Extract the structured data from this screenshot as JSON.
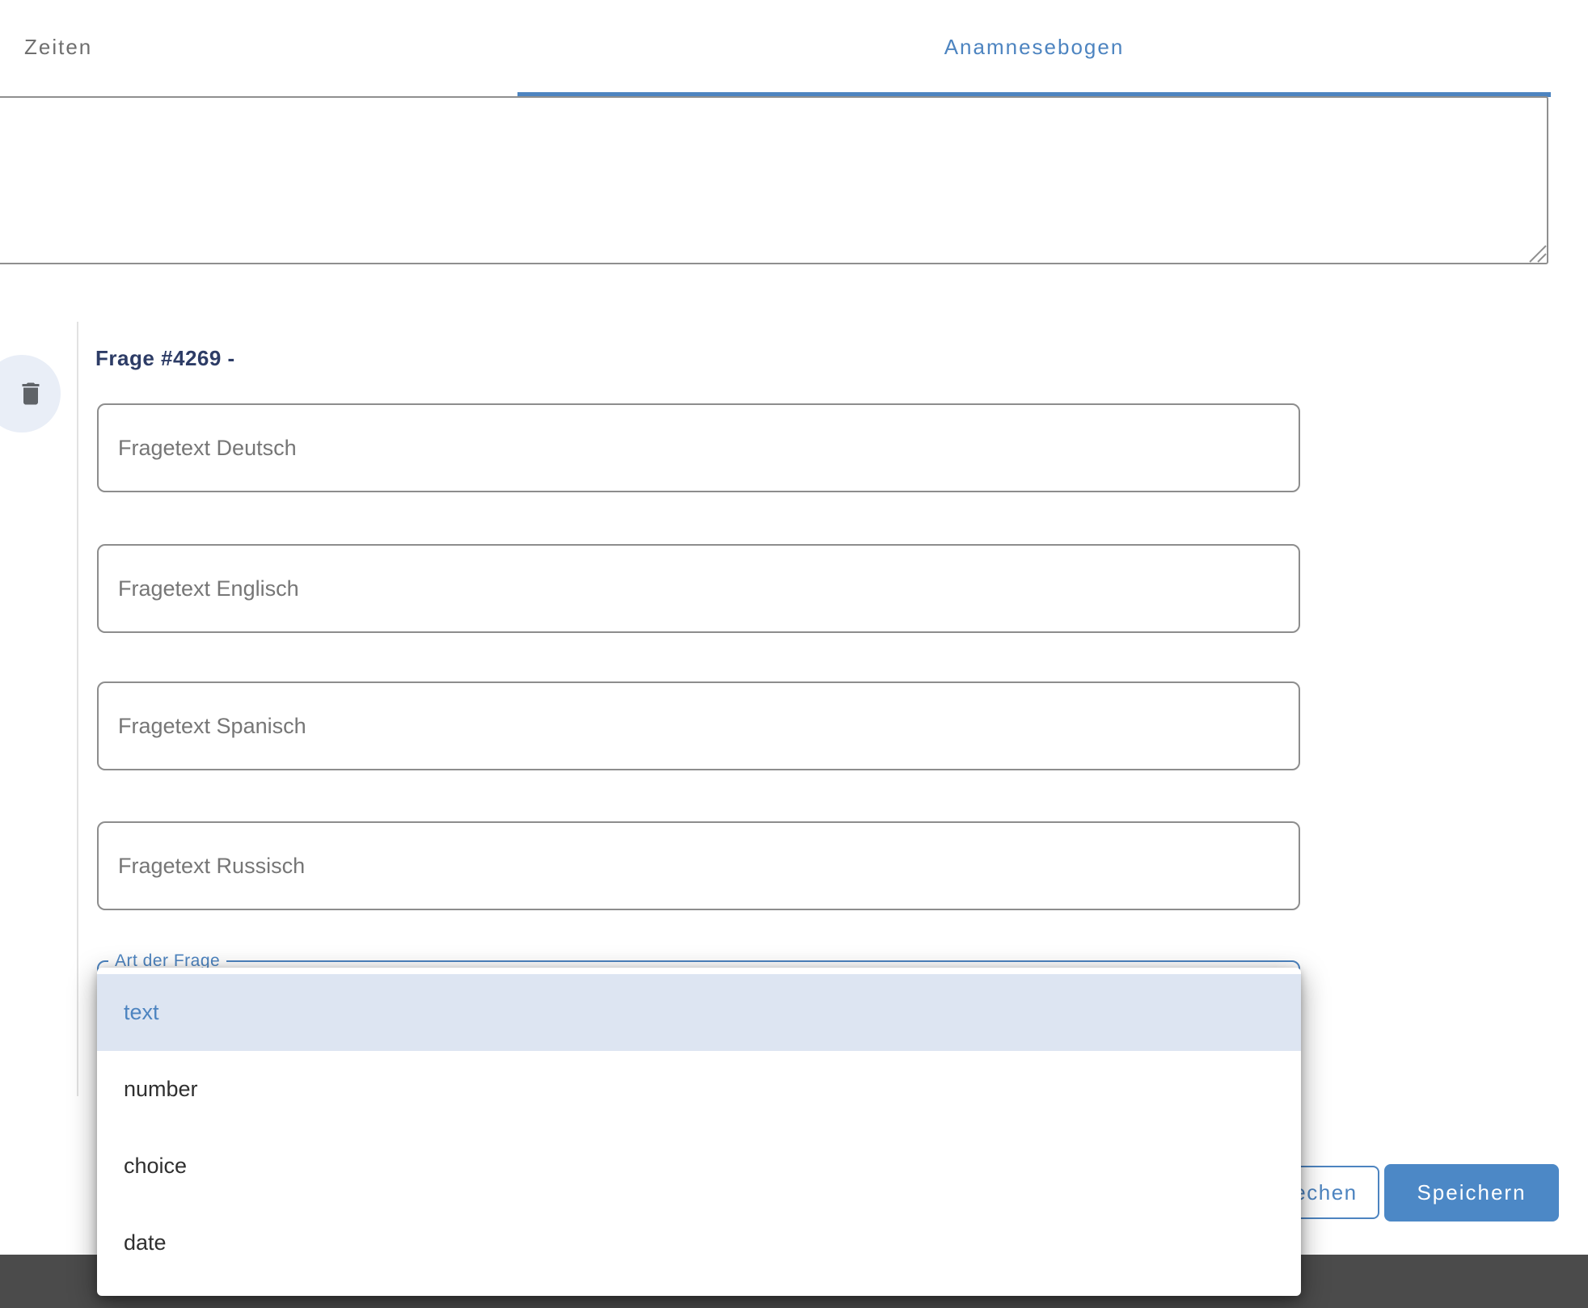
{
  "tabs": {
    "zeiten": "Zeiten",
    "anamnesebogen": "Anamnesebogen"
  },
  "textarea": {
    "value": ""
  },
  "question": {
    "title": "Frage #4269 -",
    "fields": [
      {
        "placeholder": "Fragetext Deutsch"
      },
      {
        "placeholder": "Fragetext Englisch"
      },
      {
        "placeholder": "Fragetext Spanisch"
      },
      {
        "placeholder": "Fragetext Russisch"
      }
    ],
    "type_label": "Art der Frage"
  },
  "dropdown": {
    "options": [
      {
        "label": "text",
        "selected": true
      },
      {
        "label": "number",
        "selected": false
      },
      {
        "label": "choice",
        "selected": false
      },
      {
        "label": "date",
        "selected": false
      }
    ]
  },
  "footer": {
    "cancel_label": "Abbrechen",
    "save_label": "Speichern"
  },
  "colors": {
    "accent": "#4d84c0",
    "heading": "#2d3c66",
    "option_highlight": "#dde5f2",
    "save_button": "#4c88c6",
    "bottom_bar": "#4b4b4b",
    "input_border": "#8d8d8d"
  }
}
